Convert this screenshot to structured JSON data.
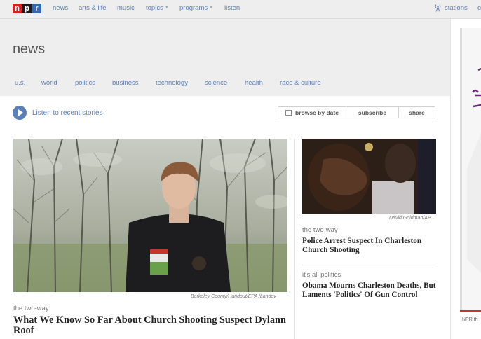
{
  "logo": {
    "letters": [
      "n",
      "p",
      "r"
    ],
    "colors": [
      "#d62021",
      "#1a1a1a",
      "#3566b0"
    ]
  },
  "topnav": {
    "items": [
      "news",
      "arts & life",
      "music",
      "topics",
      "programs",
      "listen"
    ],
    "stations": "stations",
    "cut_text": "o"
  },
  "header": {
    "title": "news",
    "subnav": [
      "u.s.",
      "world",
      "politics",
      "business",
      "technology",
      "science",
      "health",
      "race & culture"
    ]
  },
  "toolbar": {
    "listen_label": "Listen to recent stories",
    "browse_by_date": "browse by date",
    "subscribe": "subscribe",
    "share": "share"
  },
  "main_story": {
    "credit": "Berkeley County/Handout/EPA /Landov",
    "kicker": "the two-way",
    "headline": "What We Know So Far About Church Shooting Suspect Dylann Roof"
  },
  "side_stories": [
    {
      "credit": "David Goldman/AP",
      "kicker": "the two-way",
      "headline": "Police Arrest Suspect In Charleston Church Shooting"
    },
    {
      "kicker": "it's all politics",
      "headline": "Obama Mourns Charleston Deaths, But Laments 'Politics' Of Gun Control"
    }
  ],
  "ad": {
    "label": "NPR th"
  },
  "colors": {
    "link": "#5b7fb8",
    "header_bg": "#eeeeee",
    "ad_accent": "#c0392b"
  }
}
